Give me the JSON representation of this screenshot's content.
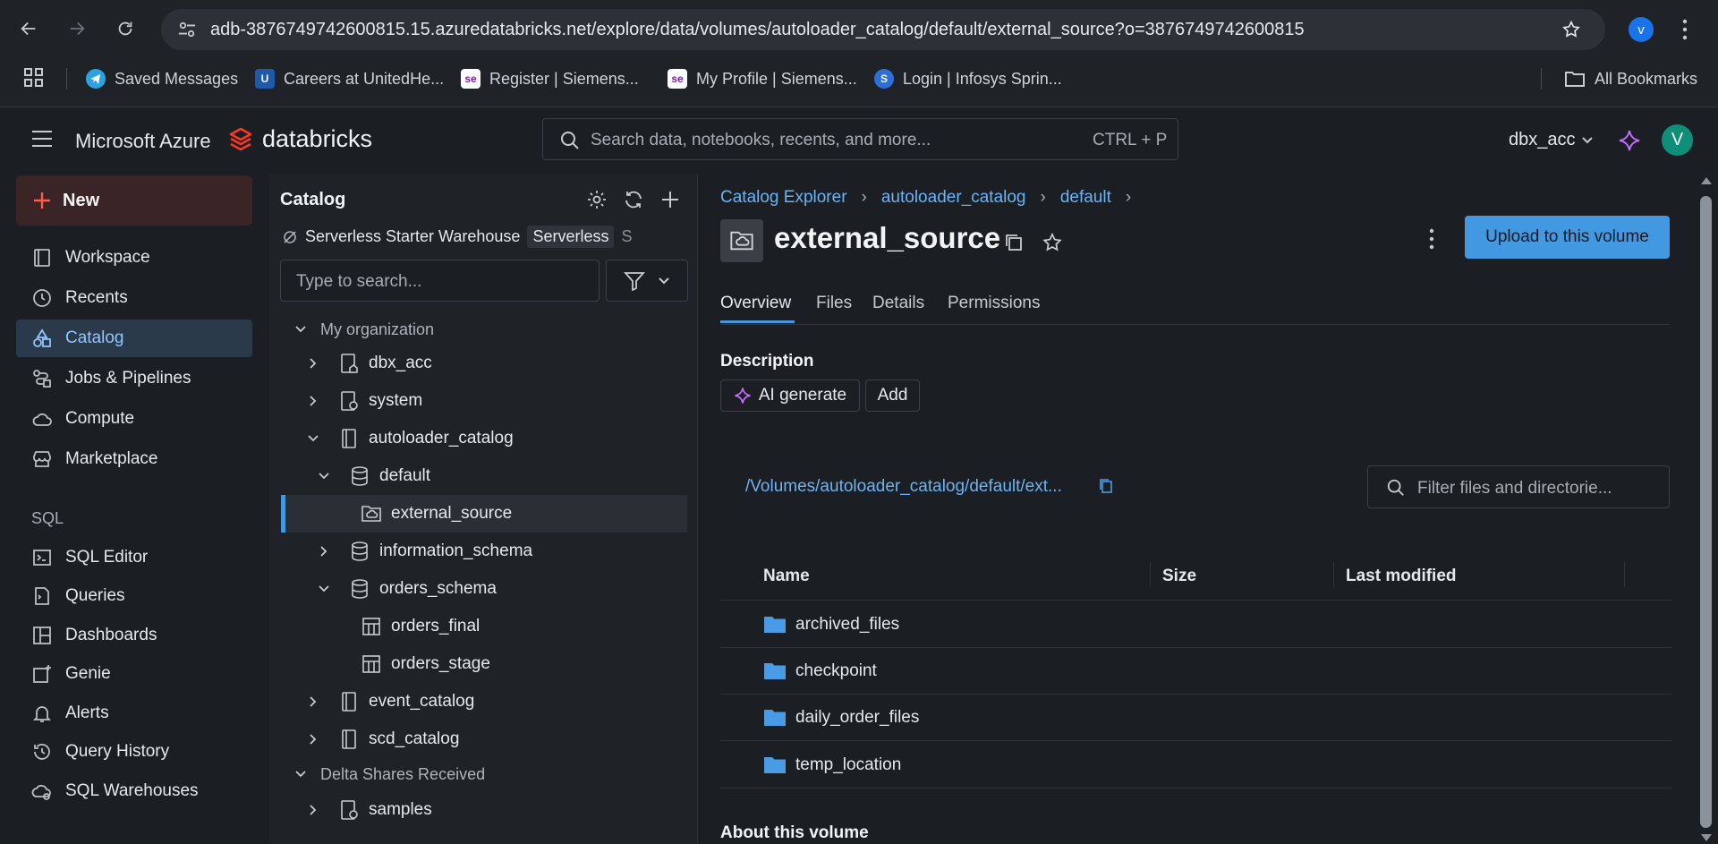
{
  "browser": {
    "url": "adb-3876749742600815.15.azuredatabricks.net/explore/data/volumes/autoloader_catalog/default/external_source?o=3876749742600815",
    "profile_initial": "v",
    "bookmarks": [
      {
        "label": "Saved Messages",
        "icon": "telegram-icon",
        "color": "#2aa3e0"
      },
      {
        "label": "Careers at UnitedHe...",
        "icon": "unitedhealth-icon",
        "color": "#1e5aa8"
      },
      {
        "label": "Register | Siemens...",
        "icon": "siemens-icon",
        "color": "#ffffff"
      },
      {
        "label": "My Profile | Siemens...",
        "icon": "siemens-icon",
        "color": "#ffffff"
      },
      {
        "label": "Login | Infosys Sprin...",
        "icon": "infosys-icon",
        "color": "#2c6fd6"
      }
    ],
    "all_bookmarks": "All Bookmarks"
  },
  "header": {
    "brand_azure": "Microsoft Azure",
    "brand_databricks": "databricks",
    "search_placeholder": "Search data, notebooks, recents, and more...",
    "search_shortcut": "CTRL + P",
    "workspace": "dbx_acc",
    "avatar_initial": "V"
  },
  "leftnav": {
    "new_label": "New",
    "items": [
      {
        "label": "Workspace",
        "icon": "workspace-icon"
      },
      {
        "label": "Recents",
        "icon": "clock-icon"
      },
      {
        "label": "Catalog",
        "icon": "catalog-icon",
        "active": true
      },
      {
        "label": "Jobs & Pipelines",
        "icon": "jobs-icon"
      },
      {
        "label": "Compute",
        "icon": "cloud-icon"
      },
      {
        "label": "Marketplace",
        "icon": "store-icon"
      }
    ],
    "sql_section": "SQL",
    "sql_items": [
      {
        "label": "SQL Editor",
        "icon": "sql-editor-icon"
      },
      {
        "label": "Queries",
        "icon": "queries-icon"
      },
      {
        "label": "Dashboards",
        "icon": "dashboard-icon"
      },
      {
        "label": "Genie",
        "icon": "genie-icon"
      },
      {
        "label": "Alerts",
        "icon": "bell-icon"
      },
      {
        "label": "Query History",
        "icon": "history-icon"
      },
      {
        "label": "SQL Warehouses",
        "icon": "warehouse-icon"
      }
    ]
  },
  "catalog_pane": {
    "title": "Catalog",
    "warehouse": "Serverless Starter Warehouse",
    "warehouse_badge": "Serverless",
    "warehouse_extra": "S",
    "search_placeholder": "Type to search...",
    "tree": {
      "my_org": "My organization",
      "dbx_acc": "dbx_acc",
      "system": "system",
      "autoloader_catalog": "autoloader_catalog",
      "default": "default",
      "external_source": "external_source",
      "information_schema": "information_schema",
      "orders_schema": "orders_schema",
      "orders_final": "orders_final",
      "orders_stage": "orders_stage",
      "event_catalog": "event_catalog",
      "scd_catalog": "scd_catalog",
      "delta_shares": "Delta Shares Received",
      "samples": "samples"
    }
  },
  "main": {
    "breadcrumb": [
      "Catalog Explorer",
      "autoloader_catalog",
      "default"
    ],
    "title": "external_source",
    "upload_button": "Upload to this volume",
    "tabs": [
      "Overview",
      "Files",
      "Details",
      "Permissions"
    ],
    "description_label": "Description",
    "ai_generate": "AI generate",
    "add": "Add",
    "volume_path": "/Volumes/autoloader_catalog/default/ext...",
    "filter_placeholder": "Filter files and directorie...",
    "columns": [
      "Name",
      "Size",
      "Last modified"
    ],
    "files": [
      "archived_files",
      "checkpoint",
      "daily_order_files",
      "temp_location"
    ],
    "about": "About this volume"
  },
  "colors": {
    "accent": "#4299e1",
    "link": "#6db2f2",
    "folder": "#4a9be6",
    "new_button_bg": "#3a2426",
    "new_plus": "#ff5c4d",
    "databricks_red": "#ff3621"
  }
}
